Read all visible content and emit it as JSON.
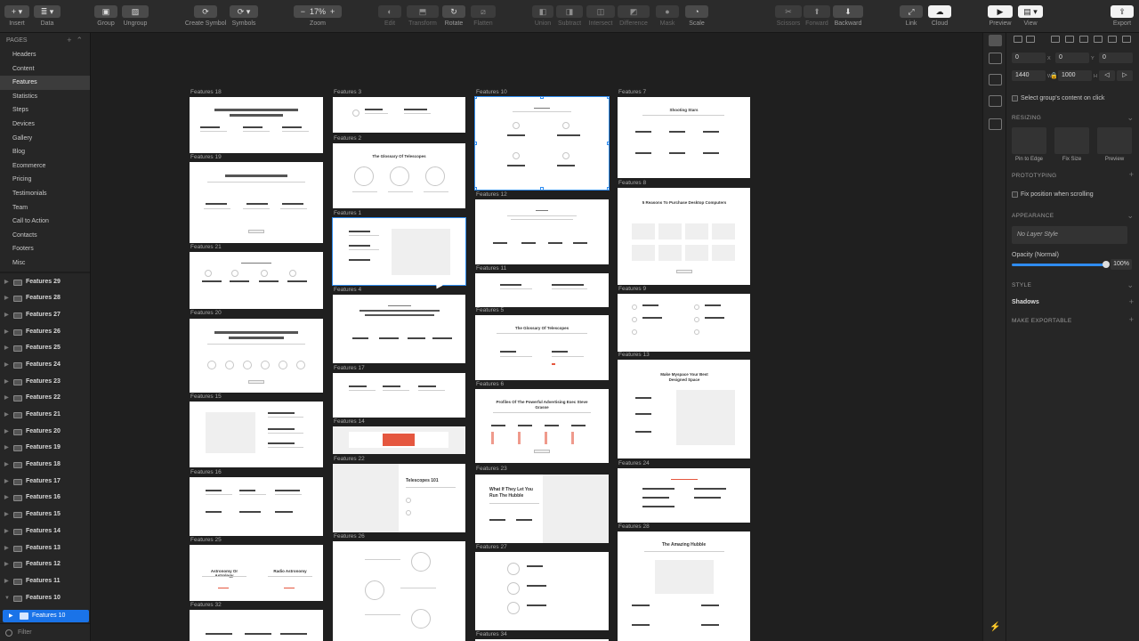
{
  "toolbar": {
    "insert": "Insert",
    "data": "Data",
    "group": "Group",
    "ungroup": "Ungroup",
    "create_symbol": "Create Symbol",
    "symbols": "Symbols",
    "zoom_label": "Zoom",
    "zoom_value": "17%",
    "edit": "Edit",
    "transform": "Transform",
    "rotate": "Rotate",
    "flatten": "Flatten",
    "union": "Union",
    "subtract": "Subtract",
    "intersect": "Intersect",
    "difference": "Difference",
    "mask": "Mask",
    "scale": "Scale",
    "scissors": "Scissors",
    "forward": "Forward",
    "backward": "Backward",
    "link": "Link",
    "cloud": "Cloud",
    "preview": "Preview",
    "view": "View",
    "export": "Export"
  },
  "sidebar": {
    "pages_title": "PAGES",
    "pages": [
      "Headers",
      "Content",
      "Features",
      "Statistics",
      "Steps",
      "Devices",
      "Gallery",
      "Blog",
      "Ecommerce",
      "Pricing",
      "Testimonials",
      "Team",
      "Call to Action",
      "Contacts",
      "Footers",
      "Misc"
    ],
    "layers": [
      "Features 29",
      "Features 28",
      "Features 27",
      "Features 26",
      "Features 25",
      "Features 24",
      "Features 23",
      "Features 22",
      "Features 21",
      "Features 20",
      "Features 19",
      "Features 18",
      "Features 17",
      "Features 16",
      "Features 15",
      "Features 14",
      "Features 13",
      "Features 12",
      "Features 11",
      "Features 10"
    ],
    "selected_layer": "Features 10",
    "filter": "Filter"
  },
  "canvas": {
    "artboards": [
      "Features 18",
      "Features 19",
      "Features 21",
      "Features 20",
      "Features 15",
      "Features 16",
      "Features 25",
      "Features 32",
      "Features 3",
      "Features 2",
      "Features 1",
      "Features 4",
      "Features 17",
      "Features 14",
      "Features 22",
      "Features 26",
      "Features 10",
      "Features 12",
      "Features 11",
      "Features 5",
      "Features 6",
      "Features 23",
      "Features 27",
      "Features 34",
      "Features 7",
      "Features 8",
      "Features 9",
      "Features 13",
      "Features 24",
      "Features 28"
    ],
    "board_texts": {
      "f18_title": "How To Excel In A Technical Job Interview",
      "f19_title": "Help Finding Information Online",
      "f20_title": "Get The Best A Birds Eye Look Into Mica Boot Camps",
      "f2_title": "The Glossary Of Telescopes",
      "f22_title": "Telescopes 101",
      "f5_title": "The Glossary Of Telescopes",
      "f6_title": "Profiles Of The Powerful Advertising Exec Steve Grasse",
      "f23_title": "What If They Let You Run The Hubble",
      "f25_left": "Astronomy Or Astrology",
      "f25_right": "Radio Astronomy",
      "f8_title": "5 Reasons To Purchase Desktop Computers",
      "f13_title": "Make Myspace Your Best Designed Space",
      "f28_title": "The Amazing Hubble",
      "f7_title": "Shooting Stars"
    }
  },
  "inspector": {
    "x": "0",
    "x_label": "X",
    "y": "0",
    "y_label": "Y",
    "rotation": "0",
    "w": "1440",
    "w_label": "W",
    "h": "1000",
    "h_label": "H",
    "select_group_content": "Select group's content on click",
    "resizing": "RESIZING",
    "pin_to_edge": "Pin to Edge",
    "fix_size": "Fix Size",
    "preview": "Preview",
    "prototyping": "PROTOTYPING",
    "fix_position": "Fix position when scrolling",
    "appearance": "APPEARANCE",
    "layer_style": "No Layer Style",
    "opacity_label": "Opacity (Normal)",
    "opacity_value": "100%",
    "style": "STYLE",
    "shadows": "Shadows",
    "make_exportable": "MAKE EXPORTABLE"
  }
}
